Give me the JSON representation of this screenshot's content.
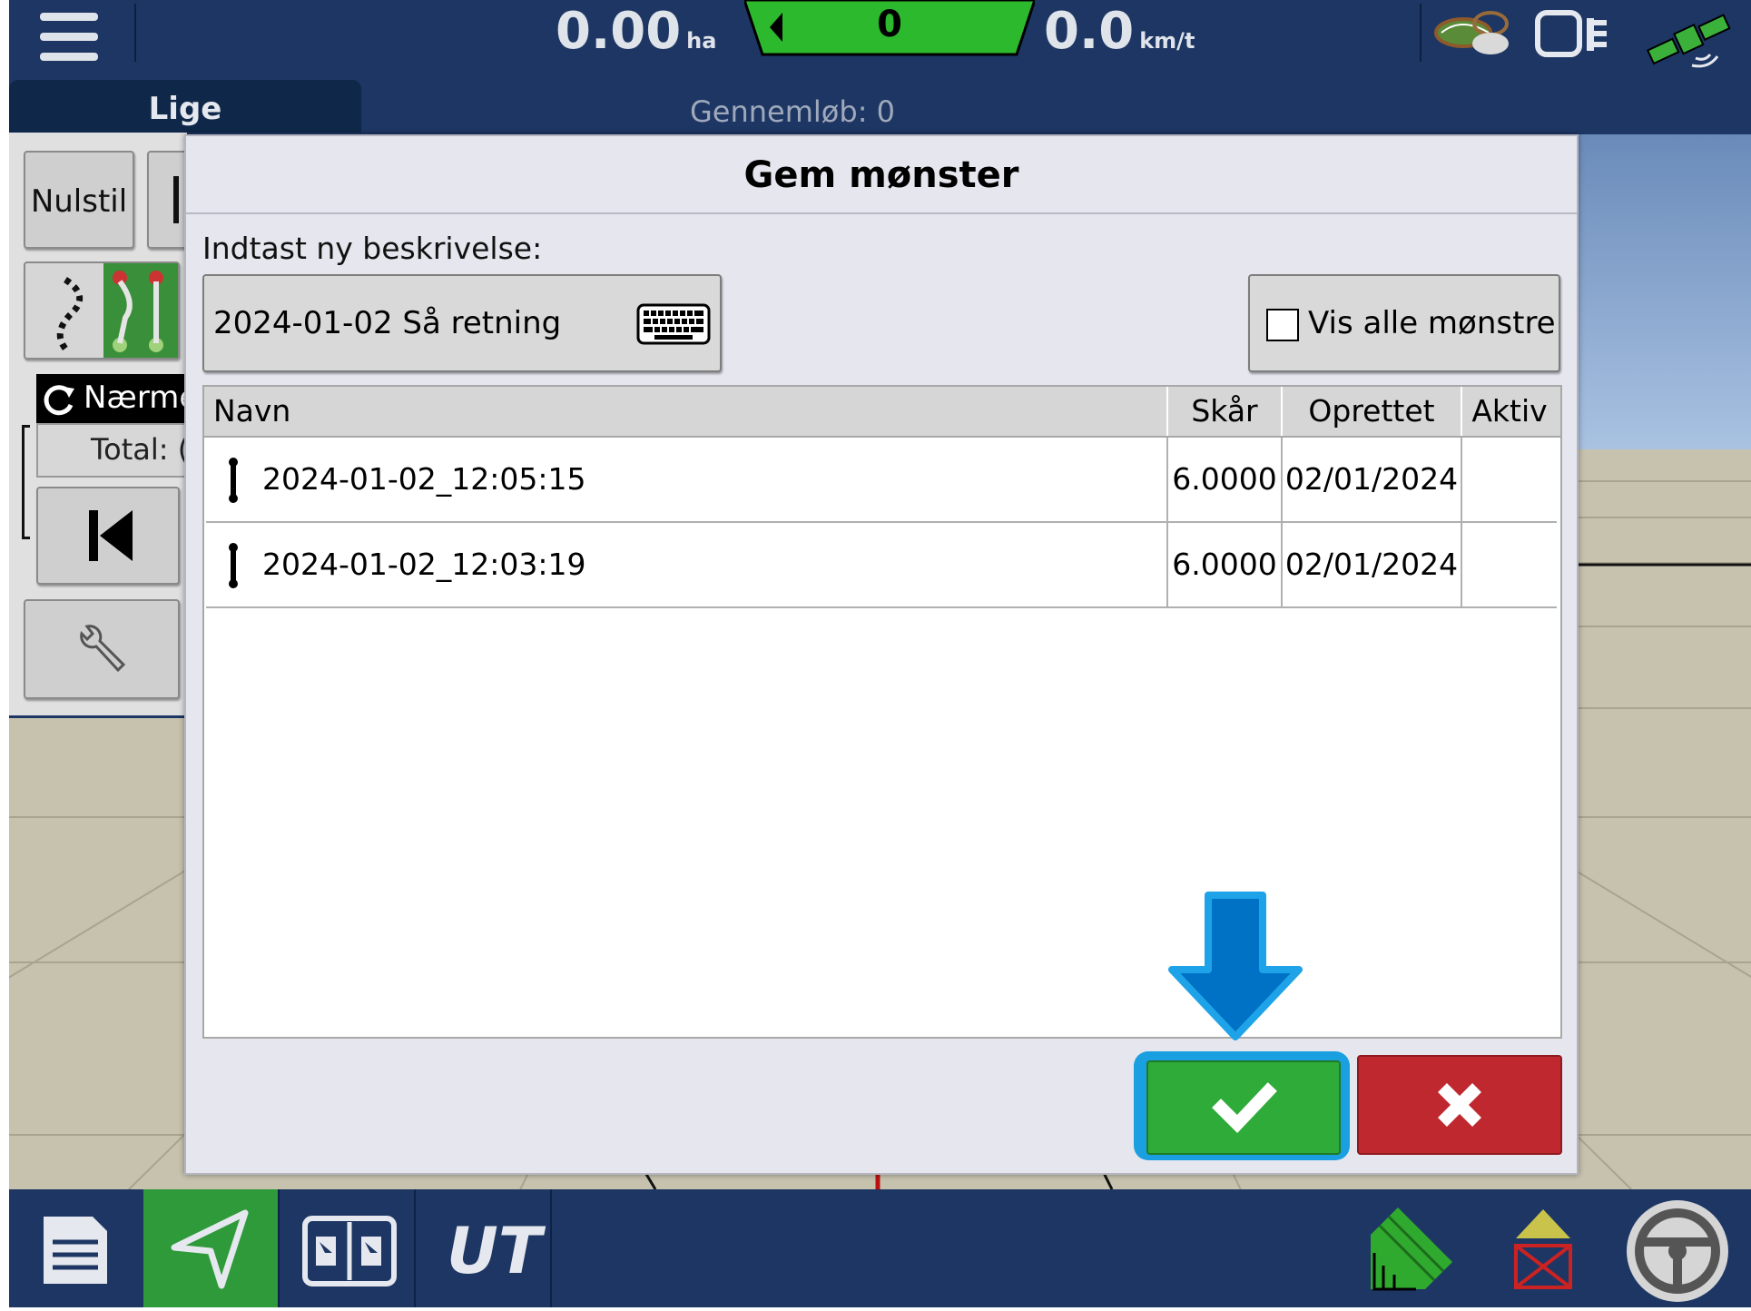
{
  "topbar": {
    "area_value": "0.00",
    "area_unit": "ha",
    "swath_number": "0",
    "speed_value": "0.0",
    "speed_unit": "km/t"
  },
  "subbar": {
    "pattern_tab": "Lige",
    "pass_count": "Gennemløb: 0"
  },
  "leftpanel": {
    "reset_label": "Nulstil",
    "nearest_label": "Nærme",
    "total_label": "Total: ("
  },
  "dialog": {
    "title": "Gem mønster",
    "description_label": "Indtast ny beskrivelse:",
    "description_value": "2024-01-02 Så retning",
    "show_all_label": "Vis alle mønstre",
    "show_all_checked": false,
    "columns": [
      "Navn",
      "Skår",
      "Oprettet",
      "Aktiv"
    ],
    "rows": [
      {
        "name": "2024-01-02_12:05:15",
        "swath": "6.0000",
        "created": "02/01/2024",
        "active": ""
      },
      {
        "name": "2024-01-02_12:03:19",
        "swath": "6.0000",
        "created": "02/01/2024",
        "active": ""
      }
    ]
  },
  "colors": {
    "bar_blue": "#1d3663",
    "ok_green": "#2fab3a",
    "cancel_red": "#c0282f",
    "highlight_blue": "#1a9fe0",
    "swath_green": "#2db92d"
  }
}
